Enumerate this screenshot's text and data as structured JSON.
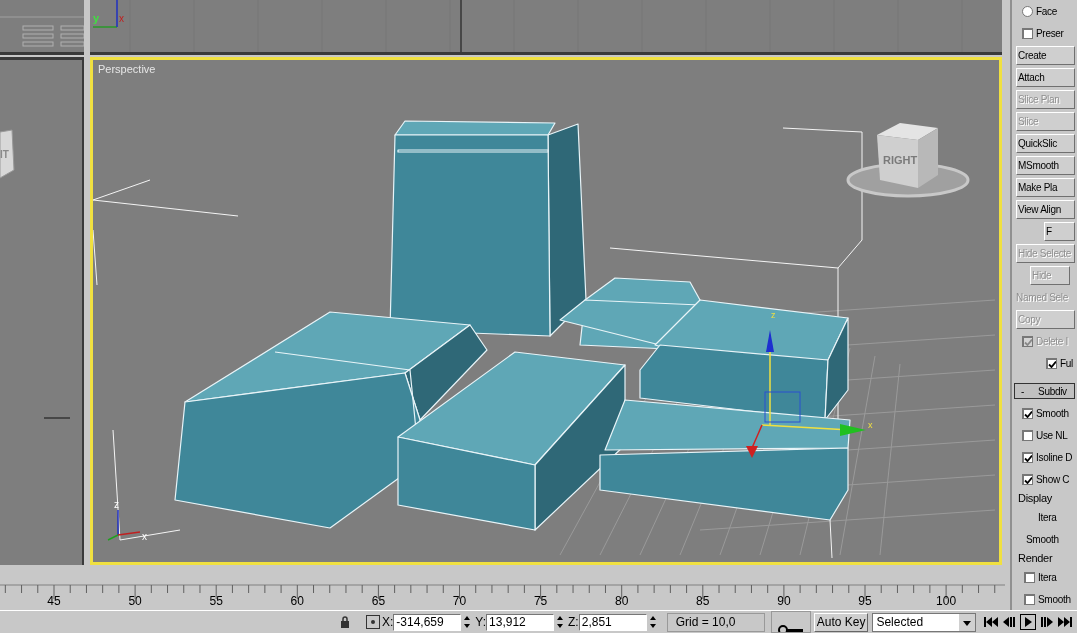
{
  "top_viewport": {
    "axis_labels": [
      "y",
      "x"
    ]
  },
  "left_viewport": {
    "cube_label": "IT"
  },
  "perspective": {
    "label": "Perspective",
    "active": true,
    "cube_label": "RIGHT",
    "gizmo_labels": [
      "z",
      "x"
    ],
    "tripod_labels": [
      "z",
      "x"
    ]
  },
  "command_panel": [
    {
      "kind": "radio",
      "label": "Face",
      "selected": false,
      "disabled": false
    },
    {
      "kind": "checkbox",
      "label": "Preser",
      "checked": false,
      "disabled": false
    },
    {
      "kind": "button",
      "label": "Create",
      "disabled": false
    },
    {
      "kind": "button",
      "label": "Attach",
      "disabled": false
    },
    {
      "kind": "button",
      "label": "Slice Plan",
      "disabled": true
    },
    {
      "kind": "button",
      "label": "Slice",
      "disabled": true
    },
    {
      "kind": "button",
      "label": "QuickSlic",
      "disabled": false
    },
    {
      "kind": "button",
      "label": "MSmooth",
      "disabled": false
    },
    {
      "kind": "button",
      "label": "Make Pla",
      "disabled": false
    },
    {
      "kind": "button",
      "label": "View Align",
      "disabled": false
    },
    {
      "kind": "narrow-button",
      "label": "F",
      "disabled": false
    },
    {
      "kind": "button",
      "label": "Hide Selecte",
      "disabled": true
    },
    {
      "kind": "narrow-button",
      "label": "Hide",
      "disabled": true
    },
    {
      "kind": "label",
      "label": "Named Sele",
      "disabled": true
    },
    {
      "kind": "button",
      "label": "Copy",
      "disabled": true
    },
    {
      "kind": "checkbox",
      "label": "Delete I",
      "checked": true,
      "disabled": true
    },
    {
      "kind": "checkbox",
      "label": "Ful",
      "checked": true,
      "disabled": false
    },
    {
      "kind": "rollout",
      "label": "Subdiv",
      "toggle": "-",
      "expanded": true,
      "disabled": false
    },
    {
      "kind": "checkbox",
      "label": "Smooth",
      "checked": true,
      "disabled": false
    },
    {
      "kind": "checkbox",
      "label": "Use NL",
      "checked": false,
      "disabled": false
    },
    {
      "kind": "checkbox",
      "label": "Isoline D",
      "checked": true,
      "disabled": false
    },
    {
      "kind": "checkbox",
      "label": "Show C",
      "checked": true,
      "disabled": false
    },
    {
      "kind": "group",
      "label": "Display",
      "disabled": false
    },
    {
      "kind": "right-label",
      "label": "Itera",
      "disabled": false
    },
    {
      "kind": "right-label",
      "label": "Smooth",
      "disabled": false
    },
    {
      "kind": "group",
      "label": "Render",
      "disabled": false
    },
    {
      "kind": "checkbox",
      "label": "Itera",
      "checked": false,
      "disabled": false
    },
    {
      "kind": "checkbox",
      "label": "Smooth",
      "checked": false,
      "disabled": false
    }
  ],
  "timeline": {
    "labels": [
      "45",
      "50",
      "55",
      "60",
      "65",
      "70",
      "75",
      "80",
      "85",
      "90",
      "95",
      "100"
    ]
  },
  "status_bar": {
    "coords": [
      {
        "axis": "X:",
        "value": "-314,659"
      },
      {
        "axis": "Y:",
        "value": "13,912"
      },
      {
        "axis": "Z:",
        "value": "2,851"
      }
    ],
    "grid": "Grid = 10,0",
    "auto_key": {
      "label": "Auto Key",
      "on": false
    },
    "key_filter": "Selected"
  }
}
